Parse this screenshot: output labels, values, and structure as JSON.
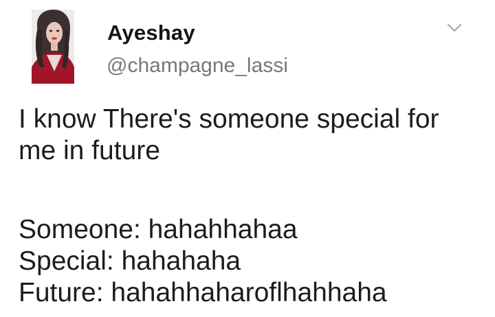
{
  "tweet": {
    "author": {
      "display_name": "Ayeshay",
      "handle": "@champagne_lassi",
      "avatar": "user-avatar-photo"
    },
    "menu_icon": "chevron-down-icon",
    "body": {
      "paragraph_1": [
        "I know There's someone special for",
        "me in future"
      ],
      "paragraph_2": [
        "Someone: hahahhahaa",
        "Special: hahahaha",
        "Future: hahahhaharoflhahhaha"
      ]
    }
  }
}
